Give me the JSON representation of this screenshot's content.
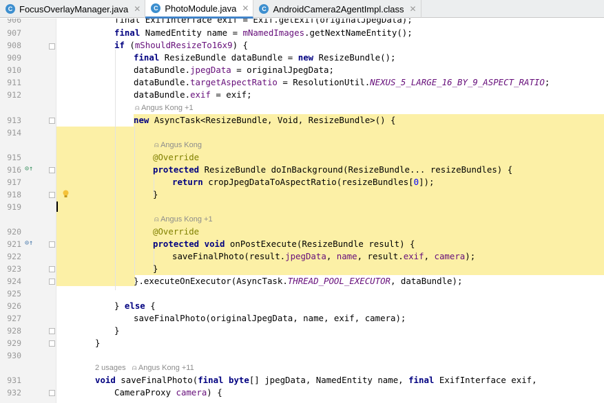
{
  "tabs": [
    {
      "label": "FocusOverlayManager.java",
      "icon": "C",
      "active": false
    },
    {
      "label": "PhotoModule.java",
      "icon": "C",
      "active": true
    },
    {
      "label": "AndroidCamera2AgentImpl.class",
      "icon": "C",
      "active": false
    }
  ],
  "close_glyph": "✕",
  "colors": {
    "highlight": "#fcf0a6",
    "keyword": "#000080",
    "field": "#660e7a",
    "annotation": "#808000",
    "number": "#0000ff",
    "tab_accent": "#4083c9"
  },
  "annotations": {
    "a1": "Angus Kong +1",
    "a2": "Angus Kong",
    "a3": "Angus Kong +1",
    "a4_usages": "2 usages",
    "a4_author": "Angus Kong +11"
  },
  "line_numbers": [
    "906",
    "907",
    "908",
    "909",
    "910",
    "911",
    "912",
    "913",
    "914",
    "915",
    "916",
    "917",
    "918",
    "919",
    "920",
    "921",
    "922",
    "923",
    "924",
    "925",
    "926",
    "927",
    "928",
    "929",
    "930",
    "931",
    "932"
  ],
  "code": {
    "l906": "final ExifInterface exif = Exif.getExif(originalJpegData);",
    "l907": [
      [
        "final",
        "kw"
      ],
      [
        " NamedEntity name = ",
        ""
      ],
      [
        "mNamedImages",
        "fld"
      ],
      [
        ".getNextNameEntity();",
        ""
      ]
    ],
    "l908": [
      [
        "if",
        "kw"
      ],
      [
        " (",
        ""
      ],
      [
        "mShouldResizeTo16x9",
        "fld"
      ],
      [
        ") {",
        ""
      ]
    ],
    "l909": [
      [
        "final",
        "kw"
      ],
      [
        " ResizeBundle dataBundle = ",
        ""
      ],
      [
        "new",
        "kw"
      ],
      [
        " ResizeBundle();",
        ""
      ]
    ],
    "l910": [
      [
        "dataBundle.",
        ""
      ],
      [
        "jpegData",
        "fld"
      ],
      [
        " = originalJpegData;",
        ""
      ]
    ],
    "l911": [
      [
        "dataBundle.",
        ""
      ],
      [
        "targetAspectRatio",
        "fld"
      ],
      [
        " = ResolutionUtil.",
        ""
      ],
      [
        "NEXUS_5_LARGE_16_BY_9_ASPECT_RATIO",
        "sfld"
      ],
      [
        ";",
        ""
      ]
    ],
    "l912": [
      [
        "dataBundle.",
        ""
      ],
      [
        "exif",
        "fld"
      ],
      [
        " = exif;",
        ""
      ]
    ],
    "l913": [
      [
        "new",
        "kw"
      ],
      [
        " AsyncTask<ResizeBundle, Void, ResizeBundle>() {",
        ""
      ]
    ],
    "l915": [
      [
        "@Override",
        "ann-c"
      ]
    ],
    "l916": [
      [
        "protected",
        "kw"
      ],
      [
        " ResizeBundle doInBackground(ResizeBundle... resizeBundles) {",
        ""
      ]
    ],
    "l917": [
      [
        "return",
        "kw"
      ],
      [
        " cropJpegDataToAspectRatio(resizeBundles[",
        ""
      ],
      [
        "0",
        "num"
      ],
      [
        "]);",
        ""
      ]
    ],
    "l918": [
      [
        "}",
        ""
      ]
    ],
    "l920": [
      [
        "@Override",
        "ann-c"
      ]
    ],
    "l921": [
      [
        "protected",
        "kw"
      ],
      [
        " ",
        ""
      ],
      [
        "void",
        "kw"
      ],
      [
        " onPostExecute(ResizeBundle result) {",
        ""
      ]
    ],
    "l922": [
      [
        "saveFinalPhoto(result.",
        ""
      ],
      [
        "jpegData",
        "fld"
      ],
      [
        ", ",
        ""
      ],
      [
        "name",
        "fld"
      ],
      [
        ", result.",
        ""
      ],
      [
        "exif",
        "fld"
      ],
      [
        ", ",
        ""
      ],
      [
        "camera",
        "fld"
      ],
      [
        ");",
        ""
      ]
    ],
    "l923": [
      [
        "}",
        ""
      ]
    ],
    "l924": [
      [
        "}.executeOnExecutor(AsyncTask.",
        ""
      ],
      [
        "THREAD_POOL_EXECUTOR",
        "sfld"
      ],
      [
        ", dataBundle);",
        ""
      ]
    ],
    "l926": [
      [
        "} ",
        ""
      ],
      [
        "else",
        "kw"
      ],
      [
        " {",
        ""
      ]
    ],
    "l927": [
      [
        "saveFinalPhoto(originalJpegData, name, exif, camera);",
        ""
      ]
    ],
    "l928": [
      [
        "}",
        ""
      ]
    ],
    "l929": [
      [
        "}",
        ""
      ]
    ],
    "l931": [
      [
        "void",
        "kw"
      ],
      [
        " saveFinalPhoto(",
        ""
      ],
      [
        "final",
        "kw"
      ],
      [
        " ",
        ""
      ],
      [
        "byte",
        "kw"
      ],
      [
        "[] jpegData, NamedEntity name, ",
        ""
      ],
      [
        "final",
        "kw"
      ],
      [
        " ExifInterface exif,",
        ""
      ]
    ],
    "l932": [
      [
        "CameraProxy ",
        ""
      ],
      [
        "camera",
        "fld"
      ],
      [
        ") {",
        ""
      ]
    ]
  }
}
